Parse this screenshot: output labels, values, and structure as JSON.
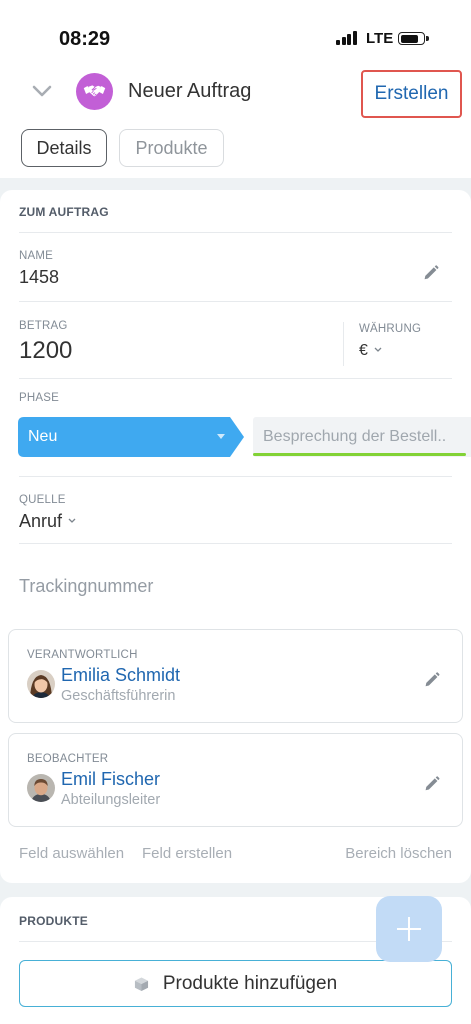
{
  "status_bar": {
    "time": "08:29",
    "network": "LTE"
  },
  "header": {
    "title": "Neuer Auftrag",
    "create_label": "Erstellen"
  },
  "tabs": [
    {
      "label": "Details",
      "selected": true
    },
    {
      "label": "Produkte",
      "selected": false
    }
  ],
  "details": {
    "section_title": "ZUM AUFTRAG",
    "name": {
      "label": "NAME",
      "value": "1458"
    },
    "amount": {
      "label": "BETRAG",
      "value": "1200"
    },
    "currency": {
      "label": "WÄHRUNG",
      "value": "€"
    },
    "phase": {
      "label": "PHASE",
      "stages": [
        {
          "label": "Neu",
          "active": true
        },
        {
          "label": "Besprechung der Bestell..",
          "active": false
        }
      ]
    },
    "source": {
      "label": "QUELLE",
      "value": "Anruf"
    },
    "tracking": {
      "placeholder": "Trackingnummer"
    },
    "responsible": {
      "label": "VERANTWORTLICH",
      "name": "Emilia Schmidt",
      "position": "Geschäftsführerin"
    },
    "observer": {
      "label": "BEOBACHTER",
      "name": "Emil Fischer",
      "position": "Abteilungsleiter"
    },
    "footer": {
      "select_field": "Feld auswählen",
      "create_field": "Feld erstellen",
      "delete_section": "Bereich löschen"
    }
  },
  "products": {
    "section_title": "PRODUKTE",
    "add_label": "Produkte hinzufügen"
  },
  "icons": {
    "back": "chevron-down-icon",
    "entity": "handshake-icon",
    "edit": "pencil-icon",
    "dropdown": "chevron-down-icon",
    "product": "box-icon",
    "add": "plus-icon",
    "signal": "signal-icon",
    "battery": "battery-icon"
  },
  "colors": {
    "accent": "#2067b0",
    "phase_active": "#3fa9f0",
    "phase_progress": "#82d235",
    "highlight": "#e0564f",
    "fab": "#c2dbf6",
    "deal_icon_bg": "#c25fd6"
  }
}
